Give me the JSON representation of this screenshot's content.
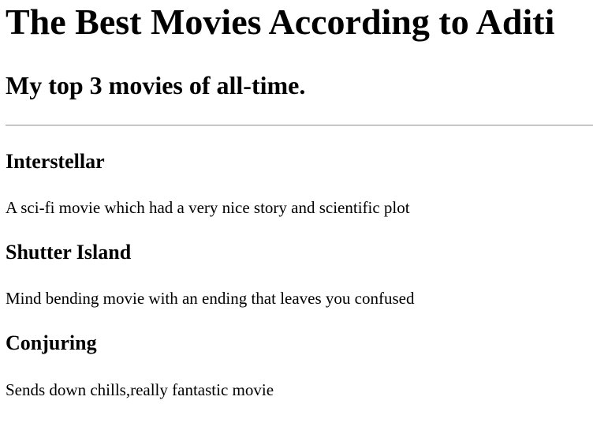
{
  "page": {
    "title": "The Best Movies According to Aditi",
    "subtitle": "My top 3 movies of all-time."
  },
  "movies": [
    {
      "title": "Interstellar",
      "description": "A sci-fi movie which had a very nice story and scientific plot"
    },
    {
      "title": "Shutter Island",
      "description": "Mind bending movie with an ending that leaves you confused"
    },
    {
      "title": "Conjuring",
      "description": "Sends down chills,really fantastic movie"
    }
  ],
  "colors": {
    "background": "#ffffff",
    "text": "#000000",
    "rule": "#9a9a9a"
  }
}
